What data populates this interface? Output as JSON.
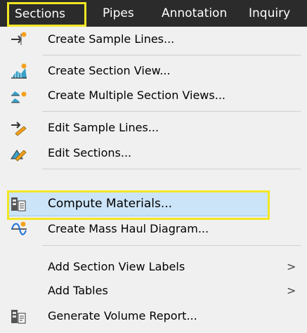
{
  "menubar": {
    "items": [
      "Sections",
      "Pipes",
      "Annotation",
      "Inquiry"
    ]
  },
  "menu": {
    "items": [
      {
        "label": "Create Sample Lines...",
        "icon": "sample-lines-icon"
      },
      {
        "label": "Create Section View...",
        "icon": "section-view-icon"
      },
      {
        "label": "Create Multiple Section Views...",
        "icon": "multiple-section-views-icon"
      },
      {
        "label": "Edit Sample Lines...",
        "icon": "edit-sample-lines-icon"
      },
      {
        "label": "Edit Sections...",
        "icon": "edit-sections-icon"
      },
      {
        "label": "Compute Materials...",
        "icon": "compute-materials-icon"
      },
      {
        "label": "Create Mass Haul Diagram...",
        "icon": "mass-haul-icon"
      },
      {
        "label": "Add Section View Labels",
        "submenu": ">"
      },
      {
        "label": "Add Tables",
        "submenu": ">"
      },
      {
        "label": "Generate Volume Report...",
        "icon": "volume-report-icon"
      }
    ]
  },
  "colors": {
    "menubar_bg": "#2b2b2b",
    "menu_bg": "#f0f0f0",
    "highlight_bg": "#cce4f7",
    "highlight_border": "#99c9ef",
    "callout": "#f2e625"
  }
}
